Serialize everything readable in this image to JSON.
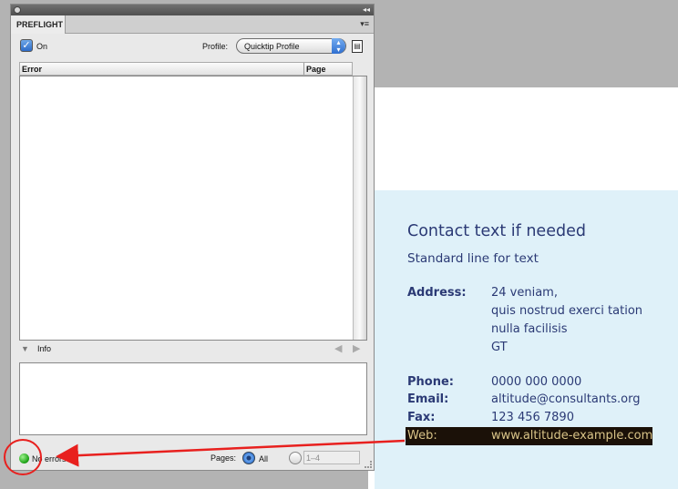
{
  "panel": {
    "tab_title": "PREFLIGHT",
    "on_label": "On",
    "profile_label": "Profile:",
    "profile_value": "Quicktip Profile",
    "columns": {
      "error": "Error",
      "page": "Page"
    },
    "info_label": "Info",
    "status_text": "No errors",
    "pages_label": "Pages:",
    "all_label": "All",
    "range_value": "1–4",
    "colors": {
      "status_ok": "#21a51a",
      "accent": "#2f6fd0"
    }
  },
  "document": {
    "title": "Contact text if needed",
    "line": "Standard line for text",
    "address_label": "Address:",
    "address_lines": [
      "24 veniam,",
      "quis nostrud exerci tation",
      "nulla facilisis",
      "GT"
    ],
    "phone_label": "Phone:",
    "phone_value": "0000 000 0000",
    "email_label": "Email:",
    "email_value": "altitude@consultants.org",
    "fax_label": "Fax:",
    "fax_value": "123 456 7890",
    "web_label": "Web:",
    "web_value": "www.altitude-example.com",
    "colors": {
      "text": "#2b3a75",
      "shade": "#dff1f9",
      "highlight": "#1b1108",
      "annotation": "#e8201e"
    }
  }
}
